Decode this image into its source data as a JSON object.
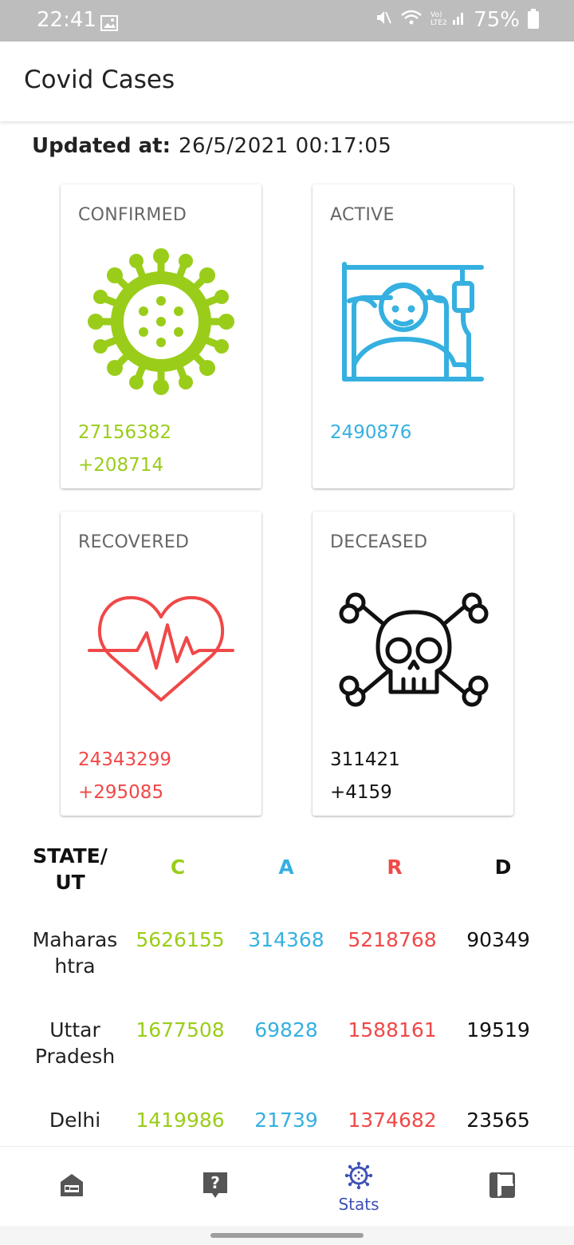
{
  "status_bar": {
    "time": "22:41",
    "battery": "75%"
  },
  "app_bar": {
    "title": "Covid Cases"
  },
  "updated": {
    "label": "Updated at:",
    "value": "26/5/2021 00:17:05"
  },
  "cards": {
    "confirmed": {
      "title": "CONFIRMED",
      "total": "27156382",
      "delta": "+208714",
      "color": "#9acd1a"
    },
    "active": {
      "title": "ACTIVE",
      "total": "2490876",
      "color": "#35b0e0"
    },
    "recovered": {
      "title": "RECOVERED",
      "total": "24343299",
      "delta": "+295085",
      "color": "#f04848"
    },
    "deceased": {
      "title": "DECEASED",
      "total": "311421",
      "delta": "+4159",
      "color": "#111111"
    }
  },
  "table": {
    "headers": {
      "state": "STATE/ UT",
      "c": "C",
      "a": "A",
      "r": "R",
      "d": "D"
    },
    "rows": [
      {
        "state": "Maharas htra",
        "c": "5626155",
        "a": "314368",
        "r": "5218768",
        "d": "90349"
      },
      {
        "state": "Uttar Pradesh",
        "c": "1677508",
        "a": "69828",
        "r": "1588161",
        "d": "19519"
      },
      {
        "state": "Delhi",
        "c": "1419986",
        "a": "21739",
        "r": "1374682",
        "d": "23565"
      }
    ]
  },
  "bottom_nav": {
    "items": [
      {
        "icon": "hospital-bed-icon"
      },
      {
        "icon": "help-question-icon"
      },
      {
        "icon": "virus-icon",
        "label": "Stats"
      },
      {
        "icon": "dashboard-icon"
      }
    ]
  }
}
